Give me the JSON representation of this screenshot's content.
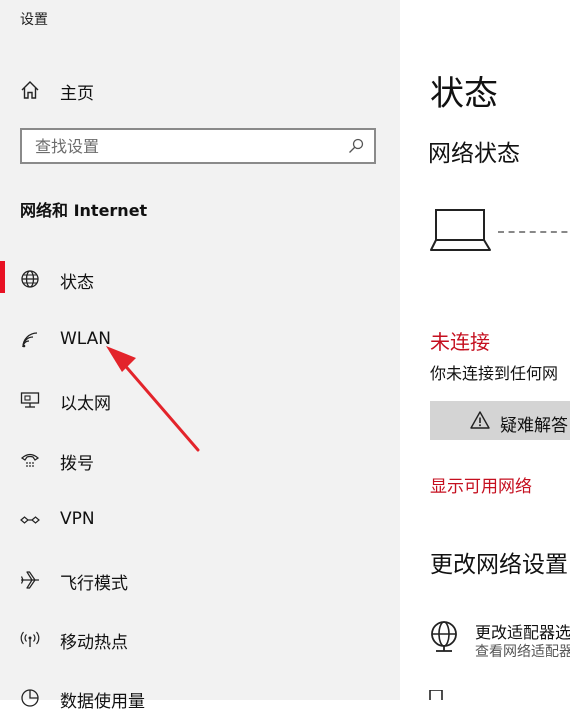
{
  "window": {
    "title": "设置"
  },
  "sidebar": {
    "home_label": "主页",
    "search_placeholder": "查找设置",
    "section_title": "网络和 Internet",
    "items": [
      {
        "label": "状态",
        "icon": "globe-icon",
        "selected": true
      },
      {
        "label": "WLAN",
        "icon": "wifi-icon",
        "selected": false
      },
      {
        "label": "以太网",
        "icon": "ethernet-icon",
        "selected": false
      },
      {
        "label": "拨号",
        "icon": "dialup-icon",
        "selected": false
      },
      {
        "label": "VPN",
        "icon": "vpn-icon",
        "selected": false
      },
      {
        "label": "飞行模式",
        "icon": "airplane-icon",
        "selected": false
      },
      {
        "label": "移动热点",
        "icon": "hotspot-icon",
        "selected": false
      },
      {
        "label": "数据使用量",
        "icon": "data-usage-icon",
        "selected": false
      }
    ]
  },
  "main": {
    "page_title": "状态",
    "network_status_heading": "网络状态",
    "connection_state": "未连接",
    "connection_desc": "你未连接到任何网",
    "troubleshoot_label": "疑难解答",
    "show_networks_link": "显示可用网络",
    "change_settings_heading": "更改网络设置",
    "adapter_title": "更改适配器选",
    "adapter_desc": "查看网络适配器"
  },
  "colors": {
    "accent": "#e81123",
    "error_red": "#c50f1f",
    "sidebar_bg": "#f2f2f2",
    "button_bg": "#d4d4d4",
    "annotation_arrow": "#e3242b"
  }
}
